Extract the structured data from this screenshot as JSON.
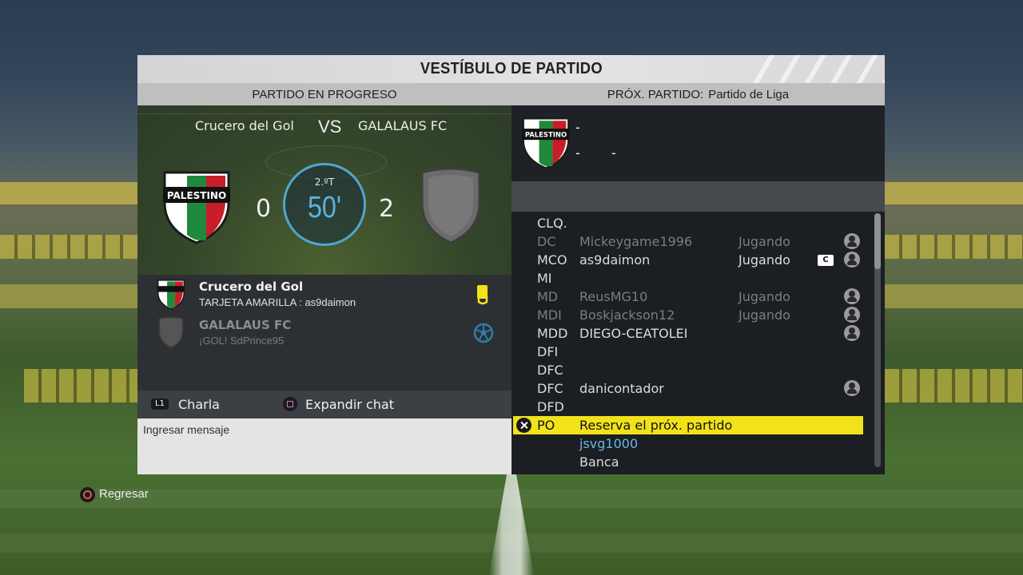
{
  "window": {
    "title": "VESTÍBULO DE PARTIDO"
  },
  "current_match": {
    "header": "PARTIDO EN PROGRESO",
    "home": {
      "name": "Crucero del Gol",
      "score": "0",
      "crest": "palestino-crest",
      "crest_text": "PALESTINO"
    },
    "vs": "VS",
    "away": {
      "name": "GALALAUS FC",
      "score": "2",
      "crest": "default-grey-shield"
    },
    "clock": {
      "period": "2.ºT",
      "minute": "50'"
    },
    "events": [
      {
        "team": "Crucero del Gol",
        "description": "TARJETA AMARILLA : as9daimon",
        "icon": "yellow-card-icon",
        "dim": false
      },
      {
        "team": "GALALAUS FC",
        "description": "¡GOL! SdPrince95",
        "icon": "ball-icon",
        "dim": true
      }
    ]
  },
  "chat": {
    "l1_button": "L1",
    "chat_label": "Charla",
    "expand_label": "Expandir chat",
    "input_placeholder": "Ingresar mensaje"
  },
  "next_match": {
    "label": "PRÓX. PARTIDO:",
    "value": "Partido de Liga",
    "crest": "palestino-crest",
    "crest_text": "PALESTINO",
    "details": [
      "-",
      "-",
      "-"
    ]
  },
  "roster": [
    {
      "pos": "CLQ.",
      "name": "",
      "status": "",
      "dim": false,
      "icon": false,
      "captain": false
    },
    {
      "pos": "DC",
      "name": "Mickeygame1996",
      "status": "Jugando",
      "dim": true,
      "icon": true,
      "captain": false
    },
    {
      "pos": "MCO",
      "name": "as9daimon",
      "status": "Jugando",
      "dim": false,
      "icon": true,
      "captain": true,
      "captain_label": "C"
    },
    {
      "pos": "MI",
      "name": "",
      "status": "",
      "dim": false,
      "icon": false,
      "captain": false
    },
    {
      "pos": "MD",
      "name": "ReusMG10",
      "status": "Jugando",
      "dim": true,
      "icon": true,
      "captain": false
    },
    {
      "pos": "MDI",
      "name": "Boskjackson12",
      "status": "Jugando",
      "dim": true,
      "icon": true,
      "captain": false
    },
    {
      "pos": "MDD",
      "name": "DIEGO-CEATOLEI",
      "status": "",
      "dim": false,
      "icon": true,
      "captain": false
    },
    {
      "pos": "DFI",
      "name": "",
      "status": "",
      "dim": false,
      "icon": false,
      "captain": false
    },
    {
      "pos": "DFC",
      "name": "",
      "status": "",
      "dim": false,
      "icon": false,
      "captain": false
    },
    {
      "pos": "DFC",
      "name": "danicontador",
      "status": "",
      "dim": false,
      "icon": true,
      "captain": false
    },
    {
      "pos": "DFD",
      "name": "",
      "status": "",
      "dim": false,
      "icon": false,
      "captain": false
    },
    {
      "pos": "PO",
      "name": "Reserva el próx. partido",
      "status": "",
      "selected": true,
      "icon": false
    },
    {
      "pos": "",
      "name": "jsvg1000",
      "status": "",
      "blue": true,
      "icon": false
    },
    {
      "pos": "",
      "name": "Banca",
      "status": "",
      "dim": false,
      "icon": false
    }
  ],
  "footer": {
    "back_label": "Regresar"
  },
  "colors": {
    "accent_yellow": "#f2e21a",
    "clock_blue": "#5ab3dd",
    "title_bar": "#dcdcdc"
  }
}
